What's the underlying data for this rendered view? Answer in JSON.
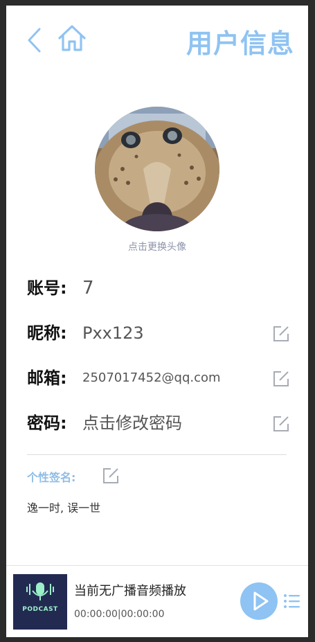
{
  "header": {
    "title": "用户信息",
    "back_icon": "chevron-left-icon",
    "home_icon": "home-icon",
    "accent_color": "#8fc3f2"
  },
  "avatar": {
    "hint": "点击更换头像"
  },
  "fields": [
    {
      "label": "账号:",
      "value": "7",
      "editable": false
    },
    {
      "label": "昵称:",
      "value": "Pxx123",
      "editable": true
    },
    {
      "label": "邮箱:",
      "value": "2507017452@qq.com",
      "editable": true
    },
    {
      "label": "密码:",
      "value": "点击修改密码",
      "editable": true
    }
  ],
  "signature": {
    "label": "个性签名:",
    "text": "逸一时, 误一世"
  },
  "player": {
    "cover_text": "PODCAST",
    "status": "当前无广播音频播放",
    "current_time": "00:00:00",
    "total_time": "00:00:00",
    "separator": "|",
    "play_color": "#8ec3f3"
  }
}
